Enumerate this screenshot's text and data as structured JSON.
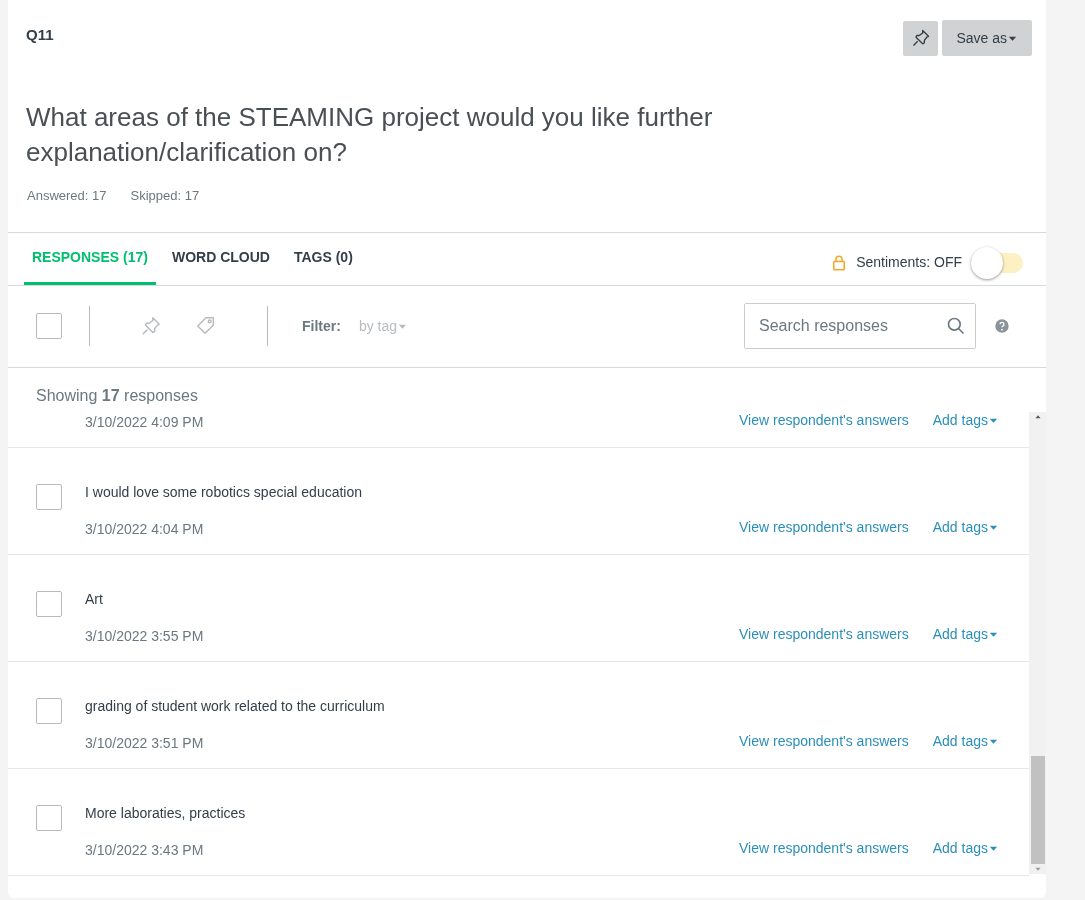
{
  "question": {
    "number": "Q11",
    "text": "What areas of the STEAMING project would you like further explanation/clarification on?",
    "answered": "Answered: 17",
    "skipped": "Skipped: 17"
  },
  "header_buttons": {
    "save_as": "Save as"
  },
  "tabs": [
    {
      "label": "RESPONSES (17)",
      "selected": true
    },
    {
      "label": "WORD CLOUD",
      "selected": false
    },
    {
      "label": "TAGS (0)",
      "selected": false
    }
  ],
  "sentiments": {
    "label": "Sentiments: OFF",
    "locked": true,
    "on": false
  },
  "toolbar": {
    "select_all_checked": false,
    "filter_label": "Filter:",
    "filter_value": "by tag",
    "search_placeholder": "Search responses"
  },
  "showing": "Showing **17** responses",
  "responses": [
    {
      "date": "3/10/2022 4:09 PM",
      "view_link": "View respondent's answers",
      "tags_link": "Add tags"
    },
    {
      "text": "I would love some robotics special education",
      "checked": false,
      "date": "3/10/2022 4:04 PM",
      "view_link": "View respondent's answers",
      "tags_link": "Add tags"
    },
    {
      "text": "Art",
      "checked": false,
      "date": "3/10/2022 3:55 PM",
      "view_link": "View respondent's answers",
      "tags_link": "Add tags"
    },
    {
      "text": "grading of student work related to the curriculum",
      "checked": false,
      "date": "3/10/2022 3:51 PM",
      "view_link": "View respondent's answers",
      "tags_link": "Add tags"
    },
    {
      "text": "More laboraties, practices",
      "checked": false,
      "date": "3/10/2022 3:43 PM",
      "view_link": "View respondent's answers",
      "tags_link": "Add tags"
    }
  ]
}
